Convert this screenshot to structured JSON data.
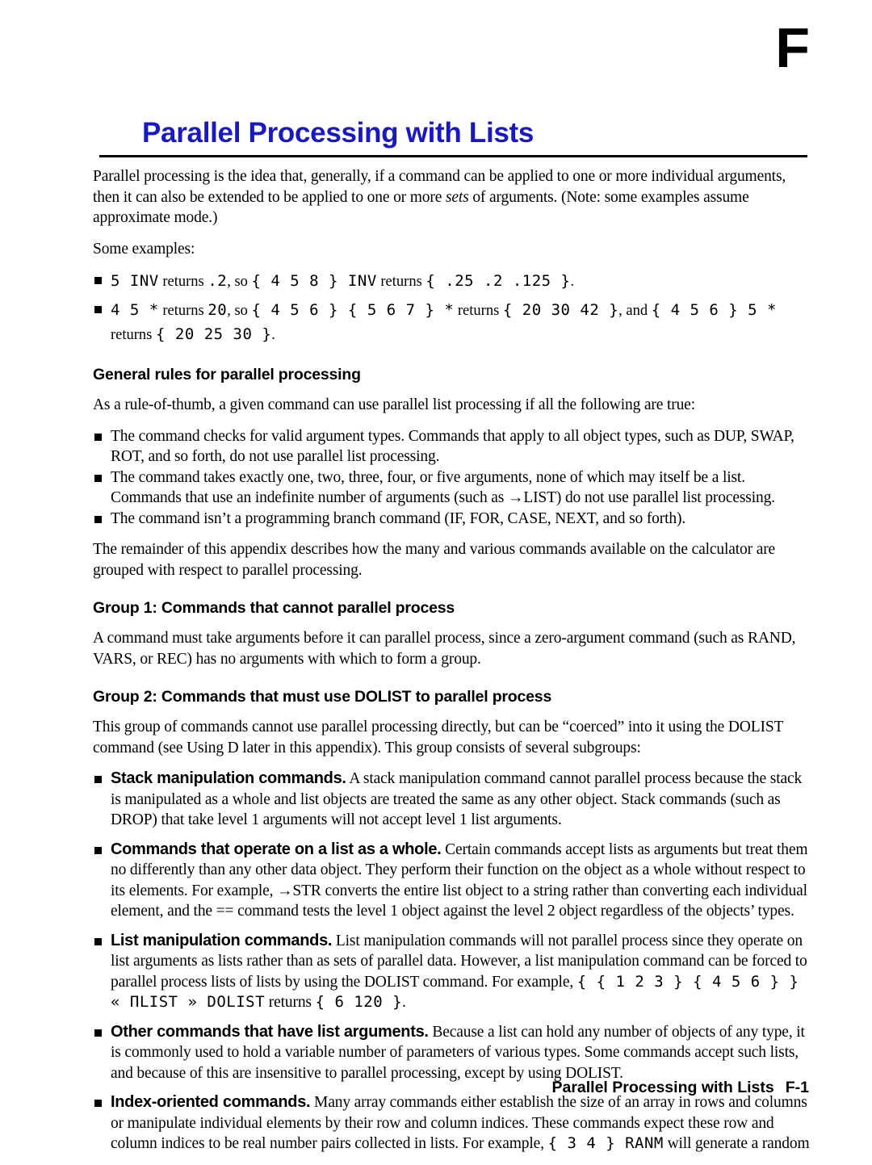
{
  "appendix_letter": "F",
  "title": {
    "text": "Parallel Processing with Lists",
    "color": "#1818c4"
  },
  "intro": {
    "paragraph_1_a": "Parallel processing is the idea that, generally, if a command can be applied to one or more individual arguments, then it can also be extended to be applied to one or more ",
    "paragraph_1_italic": "sets",
    "paragraph_1_b": " of arguments. (Note: some examples assume approximate mode.)",
    "some_examples": "Some examples:"
  },
  "examples": [
    {
      "parts": [
        {
          "style": "calc",
          "text": "5 INV"
        },
        {
          "style": "ser",
          "text": " returns "
        },
        {
          "style": "calc",
          "text": ".2"
        },
        {
          "style": "ser",
          "text": ", so "
        },
        {
          "style": "calc",
          "text": "{ 4 5 8 } INV"
        },
        {
          "style": "ser",
          "text": " returns "
        },
        {
          "style": "calc",
          "text": "{ .25 .2 .125 }"
        },
        {
          "style": "ser",
          "text": "."
        }
      ]
    },
    {
      "parts": [
        {
          "style": "calc",
          "text": "4 5 *"
        },
        {
          "style": "ser",
          "text": " returns "
        },
        {
          "style": "calc",
          "text": "20"
        },
        {
          "style": "ser",
          "text": ", so "
        },
        {
          "style": "calc",
          "text": "{ 4 5 6 } { 5 6 7 } *"
        },
        {
          "style": "ser",
          "text": " returns "
        },
        {
          "style": "calc",
          "text": "{ 20 30 42 }"
        },
        {
          "style": "ser",
          "text": ", and "
        },
        {
          "style": "calc",
          "text": "{ 4 5 6 } 5 *"
        },
        {
          "style": "ser",
          "text": " returns "
        },
        {
          "style": "calc",
          "text": "{ 20 25 30 }"
        },
        {
          "style": "ser",
          "text": "."
        }
      ]
    }
  ],
  "general_rules": {
    "heading": "General rules for parallel processing",
    "lead": "As a rule-of-thumb, a given command can use parallel list processing if all the following are true:",
    "bullets": [
      "The command checks for valid argument types. Commands that apply to all object types, such as DUP, SWAP, ROT, and so forth, do not use parallel list processing.",
      "The command takes exactly one, two, three, four, or five arguments, none of which may itself be a list. Commands that use an indefinite number of arguments (such as →LIST) do not use parallel list processing.",
      "The command isn’t a programming branch command (IF, FOR, CASE, NEXT, and so forth)."
    ],
    "closing": "The remainder of this appendix describes how the many and various commands available on the calculator are grouped with respect to parallel processing."
  },
  "group1": {
    "heading": "Group 1: Commands that cannot parallel process",
    "body": "A command must take arguments before it can parallel process, since a zero-argument command (such as RAND, VARS, or REC) has no arguments with which to form a group."
  },
  "group2": {
    "heading": "Group 2: Commands that must use DOLIST to parallel process",
    "body": "This group of commands cannot use parallel processing directly, but can be “coerced” into it using the DOLIST command (see Using D later in this appendix). This group consists of several subgroups:",
    "subgroups": [
      {
        "title": "Stack manipulation commands.",
        "text": " A stack manipulation command cannot parallel process because the stack is manipulated as a whole and list objects are treated the same as any other object. Stack commands (such as DROP) that take level 1 arguments will not accept level 1 list arguments."
      },
      {
        "title": "Commands that operate on a list as a whole.",
        "text": " Certain commands accept lists as arguments but treat them no differently than any other data object. They perform their function on the object as a whole without respect to its elements. For example, →STR converts the entire list object to a string rather than converting each individual element, and the == command tests the level 1 object against the level 2 object regardless of the objects’ types."
      },
      {
        "title": "List manipulation commands.",
        "text": " List manipulation commands will not parallel process since they operate on list arguments as lists rather than as sets of parallel data. However, a list manipulation command can be forced to parallel process lists of lists by using the DOLIST command. For example, ",
        "code_1": "{ { 1 2 3 } { 4 5 6 } }",
        "code_2": "« ΠLIST » DOLIST",
        "mid": " returns ",
        "code_3": "{ 6 120 }",
        "tail": "."
      },
      {
        "title": "Other commands that have list arguments.",
        "text": " Because a list can hold any number of objects of any type, it is commonly used to hold a variable number of parameters of various types. Some commands accept such lists, and because of this are insensitive to parallel processing, except by using DOLIST."
      },
      {
        "title": "Index-oriented commands.",
        "text": " Many array commands either establish the size of an array in rows and columns or manipulate individual elements by their row and column indices. These commands expect these row and column indices to be real number pairs collected in lists. For example, ",
        "code_1": "{ 3 4 } RANM",
        "tail": " will generate a random"
      }
    ]
  },
  "footer": {
    "title": "Parallel Processing with Lists",
    "page": "F-1"
  }
}
